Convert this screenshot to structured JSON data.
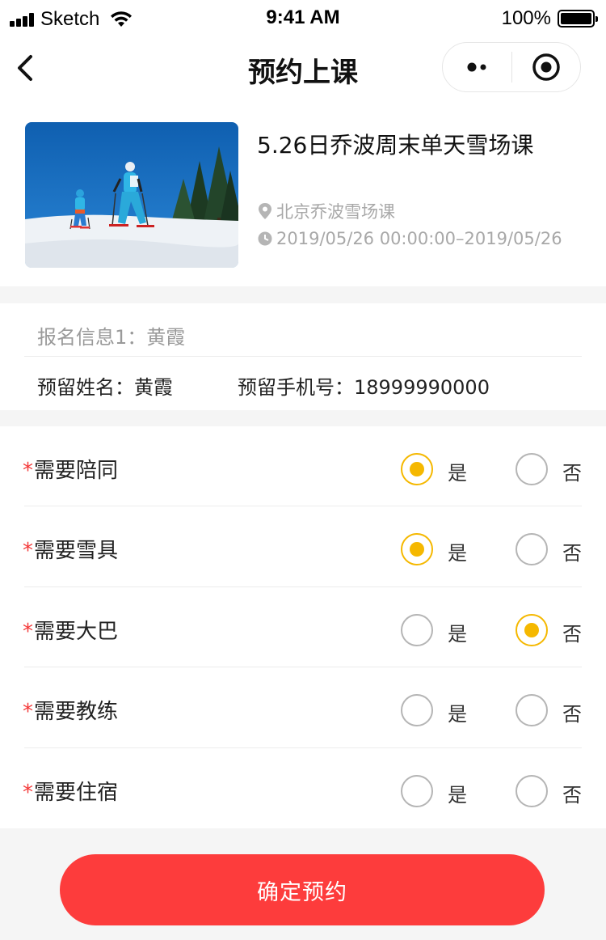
{
  "status_bar": {
    "carrier": "Sketch",
    "time": "9:41 AM",
    "battery": "100%"
  },
  "nav": {
    "title": "预约上课",
    "back_icon": "chevron-left-icon",
    "more_icon": "more-dots-icon",
    "close_icon": "target-close-icon"
  },
  "course": {
    "title": "5.26日乔波周末单天雪场课",
    "location": "北京乔波雪场课",
    "time": "2019/05/26 00:00:00–2019/05/26",
    "image": "ski-lesson-photo",
    "location_icon": "location-pin-icon",
    "time_icon": "clock-icon"
  },
  "signup": {
    "header": "报名信息1：黄霞",
    "name": "预留姓名：黄霞",
    "phone": "预留手机号：18999990000"
  },
  "options": [
    {
      "required_mark": "*",
      "label": "需要陪同",
      "yes_label": "是",
      "no_label": "否",
      "selected": "yes"
    },
    {
      "required_mark": "*",
      "label": "需要雪具",
      "yes_label": "是",
      "no_label": "否",
      "selected": "yes"
    },
    {
      "required_mark": "*",
      "label": "需要大巴",
      "yes_label": "是",
      "no_label": "否",
      "selected": "no"
    },
    {
      "required_mark": "*",
      "label": "需要教练",
      "yes_label": "是",
      "no_label": "否",
      "selected": "none"
    },
    {
      "required_mark": "*",
      "label": "需要住宿",
      "yes_label": "是",
      "no_label": "否",
      "selected": "none"
    }
  ],
  "submit_label": "确定预约",
  "colors": {
    "accent": "#f5b800",
    "primary": "#fd3c3c",
    "required": "#f43b3b"
  }
}
